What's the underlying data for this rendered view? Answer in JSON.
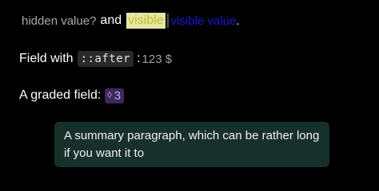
{
  "line1": {
    "hidden_text": "hidden value?",
    "and_label": "and",
    "highlight_text": "visible",
    "blue_text": "visible value",
    "trailing": "."
  },
  "line2": {
    "label": "Field with",
    "code": "::after",
    "colon": ":",
    "value": "123 $"
  },
  "line3": {
    "label": "A graded field:",
    "grade_icon": "◊",
    "grade_value": "3"
  },
  "summary": {
    "text": "A summary paragraph, which can be rather long if you want it to"
  },
  "colors": {
    "background": "#000000",
    "highlight_bg": "#e5e5a8",
    "blue_link": "#1a1ad6",
    "grade_bg": "#3c2a5a",
    "grade_fg": "#c7a4ff",
    "summary_bg": "#17302b"
  }
}
